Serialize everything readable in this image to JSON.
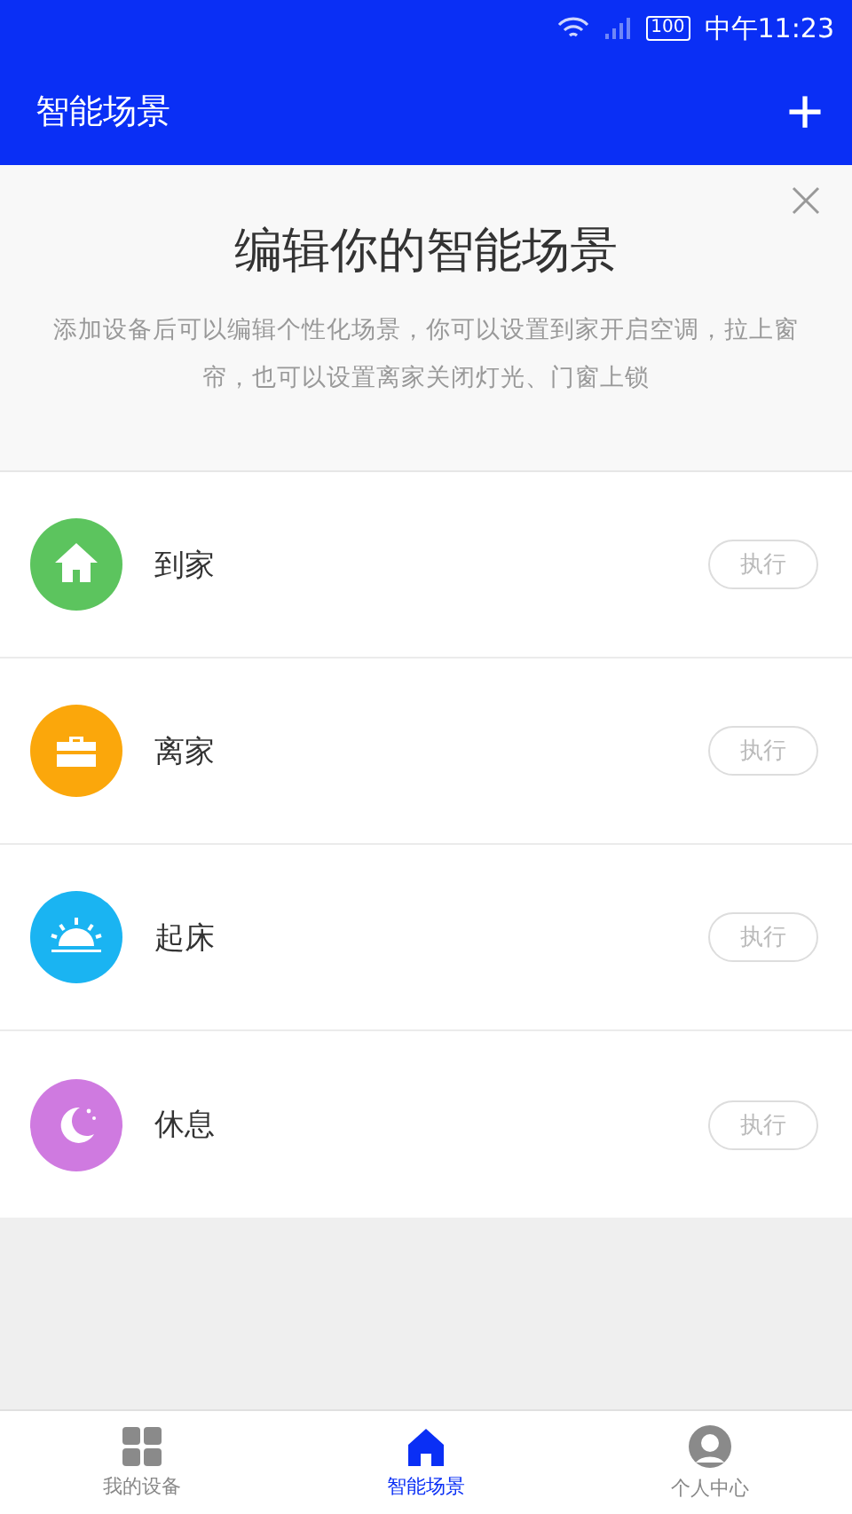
{
  "status_bar": {
    "battery": "100",
    "time": "中午11:23"
  },
  "app_bar": {
    "title": "智能场景",
    "add_icon": "+"
  },
  "banner": {
    "title": "编辑你的智能场景",
    "description": "添加设备后可以编辑个性化场景，你可以设置到家开启空调，拉上窗帘，也可以设置离家关闭灯光、门窗上锁"
  },
  "scenes": [
    {
      "kind": "home",
      "name": "到家",
      "color": "#5cc45e",
      "action": "执行",
      "disabled": true
    },
    {
      "kind": "briefcase",
      "name": "离家",
      "color": "#fba70b",
      "action": "执行",
      "disabled": true
    },
    {
      "kind": "sunrise",
      "name": "起床",
      "color": "#1ab4f2",
      "action": "执行",
      "disabled": true
    },
    {
      "kind": "moon",
      "name": "休息",
      "color": "#cf7ae0",
      "action": "执行",
      "disabled": true
    }
  ],
  "tabs": [
    {
      "kind": "grid",
      "label": "我的设备",
      "selected": false
    },
    {
      "kind": "home",
      "label": "智能场景",
      "selected": true
    },
    {
      "kind": "person",
      "label": "个人中心",
      "selected": false
    }
  ]
}
